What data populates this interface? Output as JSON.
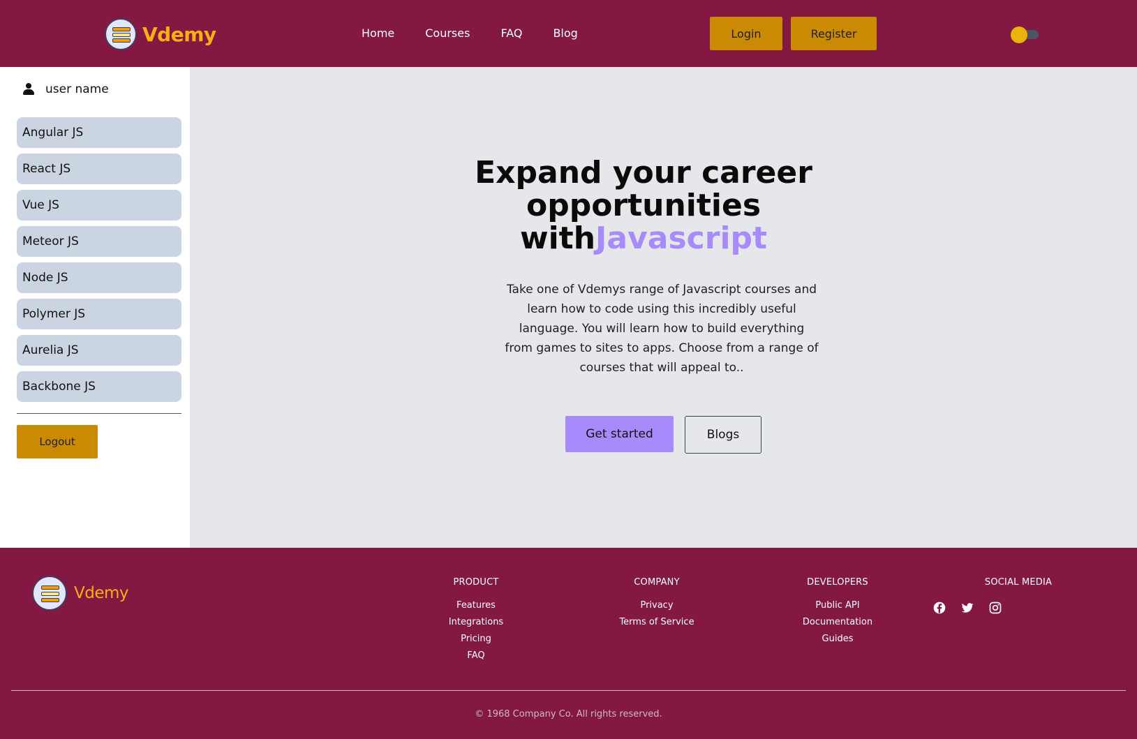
{
  "header": {
    "brand": "Vdemy",
    "nav": [
      "Home",
      "Courses",
      "FAQ",
      "Blog"
    ],
    "login_label": "Login",
    "register_label": "Register"
  },
  "sidebar": {
    "username": "user name",
    "courses": [
      "Angular JS",
      "React JS",
      "Vue JS",
      "Meteor JS",
      "Node JS",
      "Polymer JS",
      "Aurelia JS",
      "Backbone JS"
    ],
    "logout_label": "Logout"
  },
  "hero": {
    "title_line1": "Expand your career",
    "title_line2": "opportunities",
    "title_with": "with",
    "title_accent": "Javascript",
    "description": "Take one of Vdemys range of Javascript courses and learn how to code using this incredibly useful language. You will learn how to build everything from games to sites to apps. Choose from a range of courses that will appeal to..",
    "get_started_label": "Get started",
    "blogs_label": "Blogs"
  },
  "footer": {
    "brand": "Vdemy",
    "columns": [
      {
        "title": "PRODUCT",
        "links": [
          "Features",
          "Integrations",
          "Pricing",
          "FAQ"
        ]
      },
      {
        "title": "COMPANY",
        "links": [
          "Privacy",
          "Terms of Service"
        ]
      },
      {
        "title": "DEVELOPERS",
        "links": [
          "Public API",
          "Documentation",
          "Guides"
        ]
      }
    ],
    "social_title": "SOCIAL MEDIA",
    "social_icons": [
      "facebook-icon",
      "twitter-icon",
      "instagram-icon"
    ],
    "copyright": "© 1968 Company Co. All rights reserved."
  },
  "colors": {
    "brand_maroon": "#831843",
    "gold": "#ca8a04",
    "accent_purple": "#a78bfa",
    "sidebar_item": "#cbd5e1",
    "main_bg": "#e5e7eb"
  }
}
